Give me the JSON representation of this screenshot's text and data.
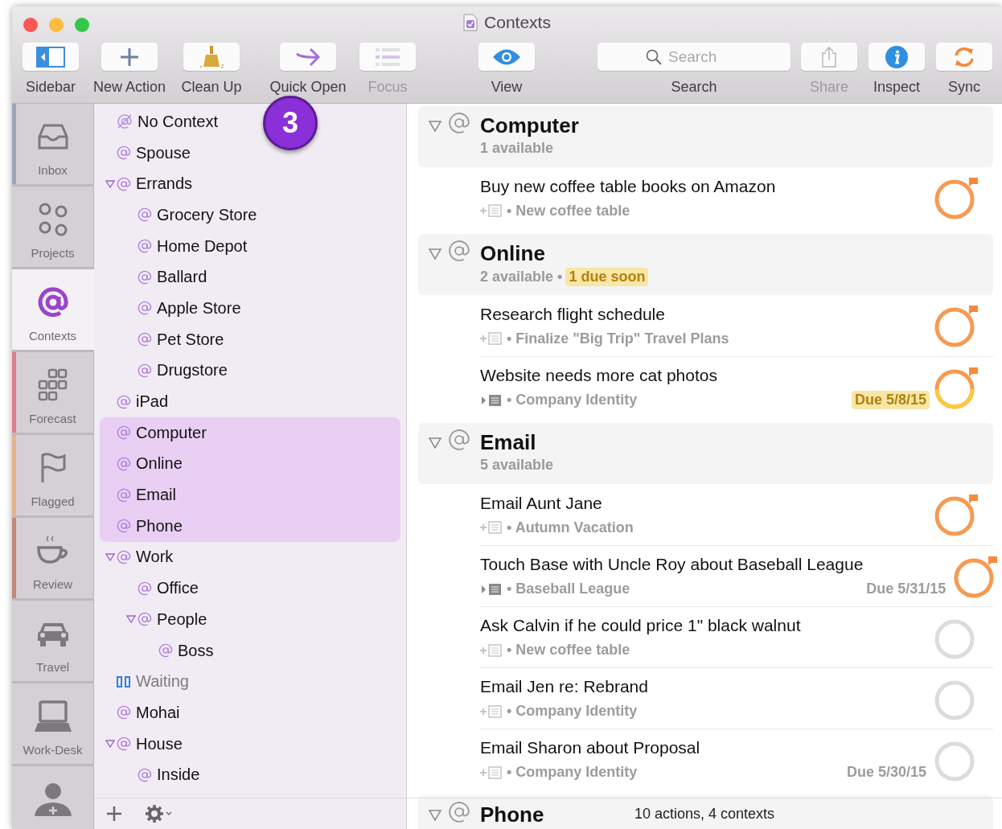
{
  "window": {
    "title": "Contexts"
  },
  "toolbar": [
    {
      "kind": "sidebar",
      "label": "Sidebar",
      "disabled": false
    },
    {
      "kind": "new_action",
      "label": "New Action",
      "disabled": false
    },
    {
      "kind": "clean_up",
      "label": "Clean Up",
      "disabled": false
    },
    {
      "kind": "quick_open",
      "label": "Quick Open",
      "disabled": false
    },
    {
      "kind": "focus",
      "label": "Focus",
      "disabled": true
    },
    {
      "kind": "view",
      "label": "View",
      "disabled": false
    },
    {
      "kind": "search",
      "label": "Search",
      "placeholder": "Search",
      "disabled": false
    },
    {
      "kind": "share",
      "label": "Share",
      "disabled": true
    },
    {
      "kind": "inspect",
      "label": "Inspect",
      "disabled": false
    },
    {
      "kind": "sync",
      "label": "Sync",
      "disabled": false
    }
  ],
  "perspectives": [
    {
      "kind": "inbox",
      "label": "Inbox",
      "selected": false,
      "color": "#9ba5bb"
    },
    {
      "kind": "projects",
      "label": "Projects",
      "selected": false
    },
    {
      "kind": "contexts",
      "label": "Contexts",
      "selected": true
    },
    {
      "kind": "forecast",
      "label": "Forecast",
      "selected": false,
      "color": "#de7e88"
    },
    {
      "kind": "flagged",
      "label": "Flagged",
      "selected": false,
      "color": "#e6b28b"
    },
    {
      "kind": "review",
      "label": "Review",
      "selected": false,
      "color": "#c48876"
    },
    {
      "kind": "travel",
      "label": "Travel",
      "selected": false
    },
    {
      "kind": "desk",
      "label": "Work-Desk",
      "selected": false
    },
    {
      "kind": "person",
      "selected": false
    }
  ],
  "badge": "3",
  "contexts": [
    {
      "label": "No Context",
      "kind": "none",
      "selected": false
    },
    {
      "label": "Spouse",
      "kind": "context",
      "selected": false
    },
    {
      "label": "Errands",
      "kind": "context",
      "selected": false,
      "expanded": true,
      "children": [
        {
          "label": "Grocery Store",
          "kind": "context",
          "selected": false
        },
        {
          "label": "Home Depot",
          "kind": "context",
          "selected": false
        },
        {
          "label": "Ballard",
          "kind": "context",
          "selected": false
        },
        {
          "label": "Apple Store",
          "kind": "context",
          "selected": false
        },
        {
          "label": "Pet Store",
          "kind": "context",
          "selected": false
        },
        {
          "label": "Drugstore",
          "kind": "context",
          "selected": false
        }
      ]
    },
    {
      "label": "iPad",
      "kind": "context",
      "selected": false
    },
    {
      "label": "Computer",
      "kind": "context",
      "selected": true
    },
    {
      "label": "Online",
      "kind": "context",
      "selected": true
    },
    {
      "label": "Email",
      "kind": "context",
      "selected": true
    },
    {
      "label": "Phone",
      "kind": "context",
      "selected": true
    },
    {
      "label": "Work",
      "kind": "context",
      "selected": false,
      "expanded": true,
      "children": [
        {
          "label": "Office",
          "kind": "context",
          "selected": false
        },
        {
          "label": "People",
          "kind": "context",
          "selected": false,
          "expanded": true,
          "children": [
            {
              "label": "Boss",
              "kind": "context",
              "selected": false
            }
          ]
        }
      ]
    },
    {
      "label": "Waiting",
      "kind": "on_hold",
      "selected": false
    },
    {
      "label": "Mohai",
      "kind": "context",
      "selected": false
    },
    {
      "label": "House",
      "kind": "context",
      "selected": false,
      "expanded": true,
      "children": [
        {
          "label": "Inside",
          "kind": "context",
          "selected": false
        }
      ]
    }
  ],
  "groups": [
    {
      "title": "Computer",
      "available": "1 available",
      "expanded": true,
      "rows": [
        {
          "title": "Buy new coffee table books on Amazon",
          "kind": "add_note",
          "project": "• New coffee table",
          "flagged": true,
          "due_soon": false
        }
      ]
    },
    {
      "title": "Online",
      "available": "2 available •",
      "due_note": "1 due soon",
      "expanded": true,
      "rows": [
        {
          "title": "Research flight schedule",
          "kind": "add_note",
          "project": "• Finalize \"Big Trip\" Travel Plans",
          "flagged": true,
          "due_soon": false
        },
        {
          "title": "Website needs more cat photos",
          "kind": "has_note",
          "project": "• Company Identity",
          "due": "Due 5/8/15",
          "flagged": true,
          "due_soon": true
        }
      ]
    },
    {
      "title": "Email",
      "available": "5 available",
      "expanded": true,
      "rows": [
        {
          "title": "Email Aunt Jane",
          "kind": "add_note",
          "project": "• Autumn Vacation",
          "flagged": true,
          "due_soon": false
        },
        {
          "title": "Touch Base with Uncle Roy about Baseball League",
          "kind": "has_note",
          "project": "• Baseball League",
          "due": "Due 5/31/15",
          "flagged": true,
          "due_soon": false
        },
        {
          "title": "Ask Calvin if he could price 1\" black walnut",
          "kind": "add_note",
          "project": "• New coffee table",
          "flagged": false,
          "due_soon": false
        },
        {
          "title": "Email Jen re: Rebrand",
          "kind": "add_note",
          "project": "• Company Identity",
          "flagged": false,
          "due_soon": false
        },
        {
          "title": "Email Sharon about Proposal",
          "kind": "add_note",
          "project": "• Company Identity",
          "due": "Due 5/30/15",
          "flagged": false,
          "due_soon": false
        }
      ]
    },
    {
      "title": "Phone",
      "expanded": true
    }
  ],
  "status_bar": "10 actions, 4 contexts"
}
